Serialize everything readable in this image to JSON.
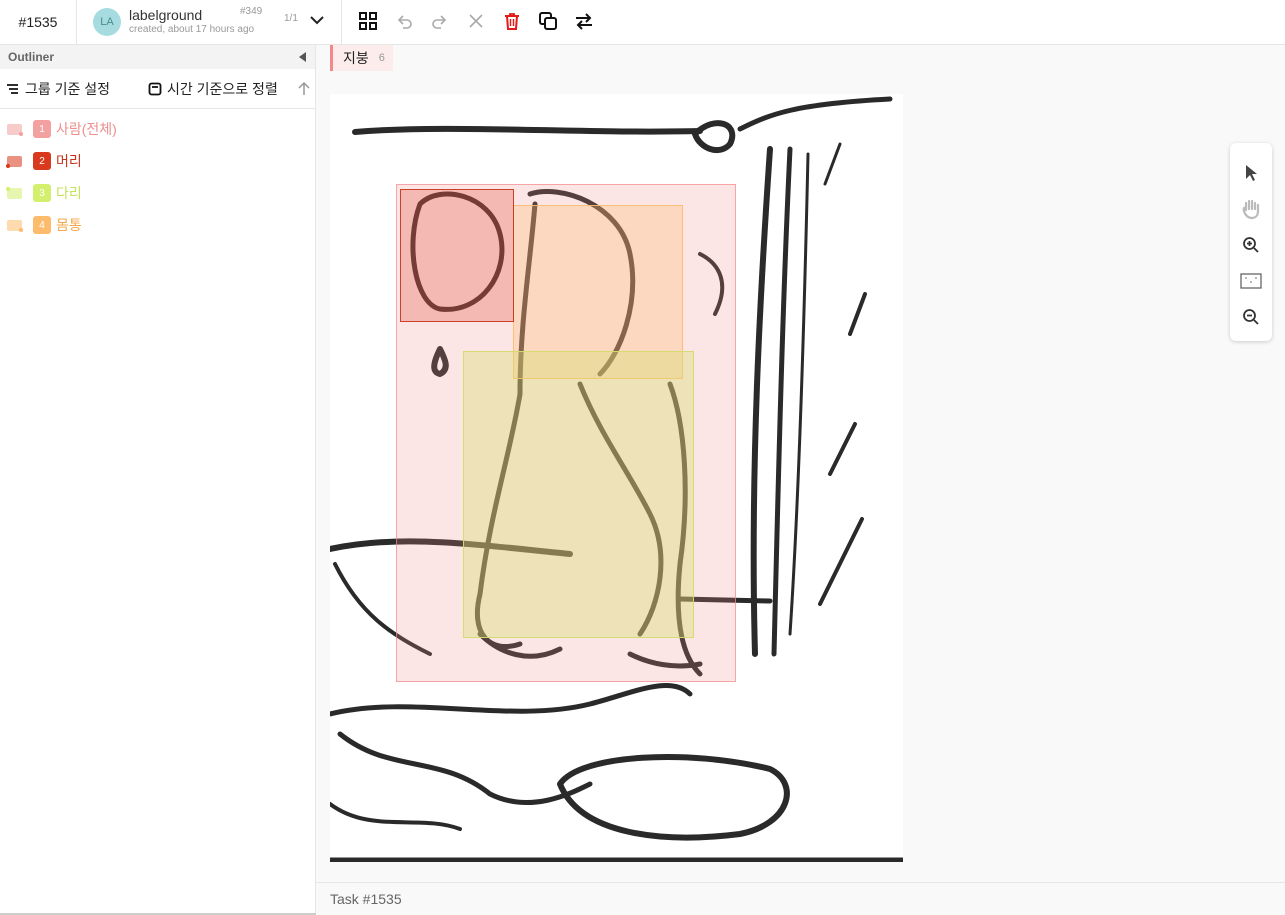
{
  "header": {
    "task_id": "#1535",
    "user": {
      "initials": "LA",
      "name": "labelground",
      "created": "created, about 17 hours ago",
      "annotation_id": "#349",
      "count": "1/1"
    },
    "tools": [
      "grid-icon",
      "undo-icon",
      "redo-icon",
      "close-icon",
      "delete-icon",
      "duplicate-icon",
      "swap-icon"
    ]
  },
  "sidebar": {
    "title": "Outliner",
    "group_label": "그룹 기준 설정",
    "order_label": "시간 기준으로 정렬",
    "labels": [
      {
        "num": "1",
        "name": "사람(전체)",
        "color": "#f3a0a0",
        "text_color": "#ee8f8f"
      },
      {
        "num": "2",
        "name": "머리",
        "color": "#d9391c",
        "text_color": "#c8321a"
      },
      {
        "num": "3",
        "name": "다리",
        "color": "#d4ef6e",
        "text_color": "#c5e25a"
      },
      {
        "num": "4",
        "name": "몸통",
        "color": "#fdbb6d",
        "text_color": "#f4a84a"
      }
    ]
  },
  "selection": {
    "label": "지붕",
    "count": "6"
  },
  "canvas_tools": [
    "pointer-icon",
    "hand-icon",
    "zoom-in-icon",
    "zoom-fit-icon",
    "zoom-out-icon"
  ],
  "footer": {
    "text": "Task #1535"
  }
}
